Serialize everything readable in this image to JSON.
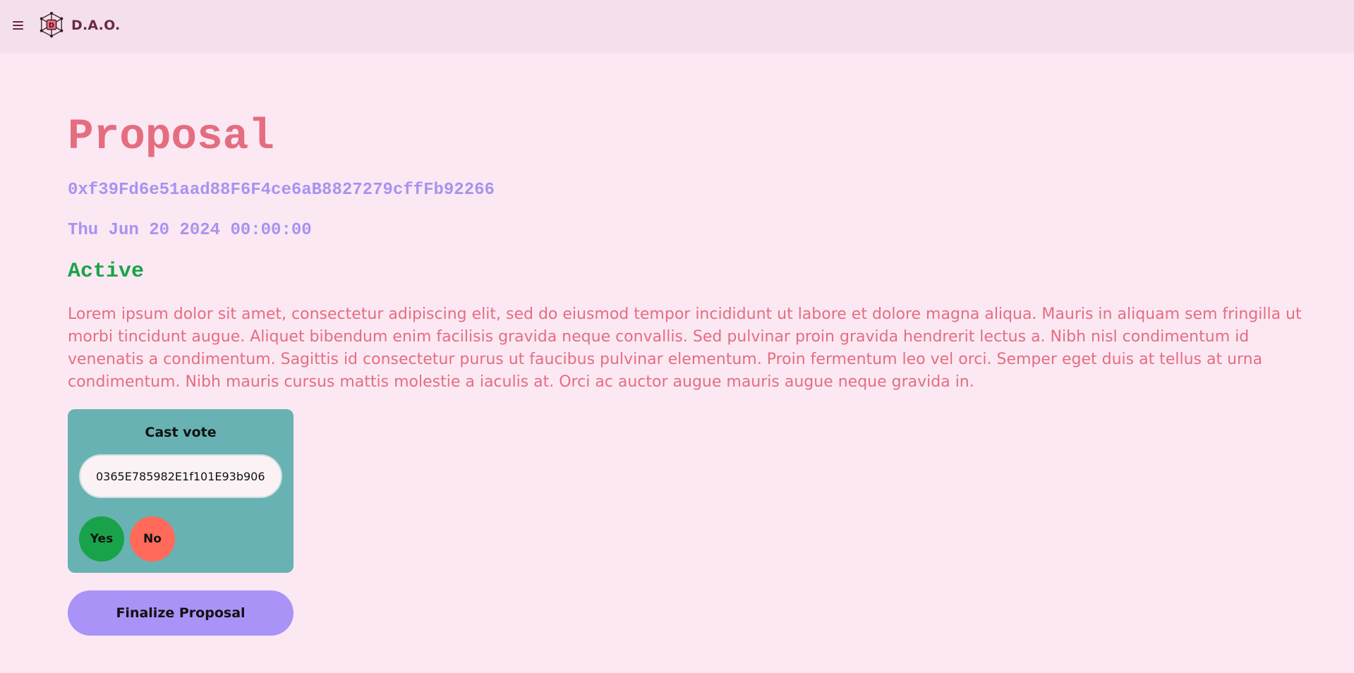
{
  "header": {
    "brand": "D.A.O.",
    "menu_icon": "hamburger-menu-icon",
    "logo_icon": "dao-network-logo-icon",
    "logo_letter": "D"
  },
  "proposal": {
    "title": "Proposal",
    "address": "0xf39Fd6e51aad88F6F4ce6aB8827279cffFb92266",
    "date": "Thu Jun 20 2024 00:00:00",
    "status": "Active",
    "description": "Lorem ipsum dolor sit amet, consectetur adipiscing elit, sed do eiusmod tempor incididunt ut labore et dolore magna aliqua. Mauris in aliquam sem fringilla ut morbi tincidunt augue. Aliquet bibendum enim facilisis gravida neque convallis. Sed pulvinar proin gravida hendrerit lectus a. Nibh nisl condimentum id venenatis a condimentum. Sagittis id consectetur purus ut faucibus pulvinar elementum. Proin fermentum leo vel orci. Semper eget duis at tellus at urna condimentum. Nibh mauris cursus mattis molestie a iaculis at. Orci ac auctor augue mauris augue neque gravida in."
  },
  "vote": {
    "title": "Cast vote",
    "input_value": "0365E785982E1f101E93b906",
    "yes_label": "Yes",
    "no_label": "No"
  },
  "actions": {
    "finalize_label": "Finalize Proposal"
  },
  "colors": {
    "background": "#fbe8f3",
    "header_bg": "#f3e0ec",
    "title": "#e56d80",
    "address": "#a893f0",
    "status_active": "#1aa34a",
    "vote_card": "#68b2b3",
    "yes": "#18a34a",
    "no": "#ff6a5b",
    "finalize": "#a993f6"
  }
}
